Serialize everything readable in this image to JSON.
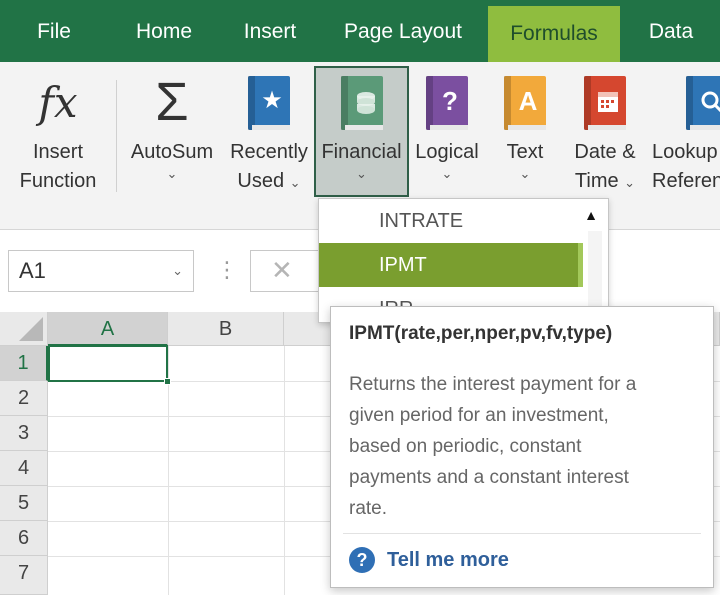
{
  "menu": {
    "tabs": [
      {
        "label": "File"
      },
      {
        "label": "Home"
      },
      {
        "label": "Insert"
      },
      {
        "label": "Page Layout"
      },
      {
        "label": "Formulas"
      },
      {
        "label": "Data"
      }
    ],
    "active_tab": "Formulas"
  },
  "ribbon": {
    "insert_function": {
      "line1": "Insert",
      "line2": "Function",
      "icon": "fx-icon",
      "glyph": "fx"
    },
    "autosum": {
      "label": "AutoSum",
      "icon": "sigma-icon",
      "glyph": "Σ"
    },
    "recently_used": {
      "line1": "Recently",
      "line2": "Used",
      "icon": "star-book-icon",
      "glyph": "★"
    },
    "financial": {
      "label": "Financial",
      "icon": "coins-book-icon"
    },
    "logical": {
      "label": "Logical",
      "icon": "question-book-icon",
      "glyph": "?"
    },
    "text": {
      "label": "Text",
      "icon": "letter-a-book-icon",
      "glyph": "A"
    },
    "date_time": {
      "line1": "Date &",
      "line2": "Time",
      "icon": "calendar-book-icon"
    },
    "lookup": {
      "line1": "Lookup",
      "line2": "Reference",
      "icon": "magnifier-book-icon"
    },
    "chevron": "⌄",
    "colors": {
      "recently_used": "#2e75b6",
      "financial": "#5b9a78",
      "logical": "#7b4fa0",
      "text": "#f2a93b",
      "date_time": "#d5472f",
      "lookup": "#2e75b6"
    }
  },
  "formula_bar": {
    "name_box": "A1",
    "cancel_glyph": "✕",
    "dots": "⋮"
  },
  "sheet": {
    "columns": [
      "A",
      "B"
    ],
    "rows": [
      "1",
      "2",
      "3",
      "4",
      "5",
      "6",
      "7"
    ],
    "active_cell": "A1"
  },
  "financial_dropdown": {
    "items": [
      {
        "label": "INTRATE",
        "highlighted": false
      },
      {
        "label": "IPMT",
        "highlighted": true
      },
      {
        "label": "IRR",
        "highlighted": false
      }
    ],
    "scroll_glyph": "▲"
  },
  "tooltip": {
    "signature": "IPMT(rate,per,nper,pv,fv,type)",
    "description_lines": [
      "Returns the interest payment for a",
      "given period for an investment,",
      "based on periodic, constant",
      "payments and a constant interest",
      "rate."
    ],
    "help_glyph": "?",
    "help_link": "Tell me more"
  }
}
